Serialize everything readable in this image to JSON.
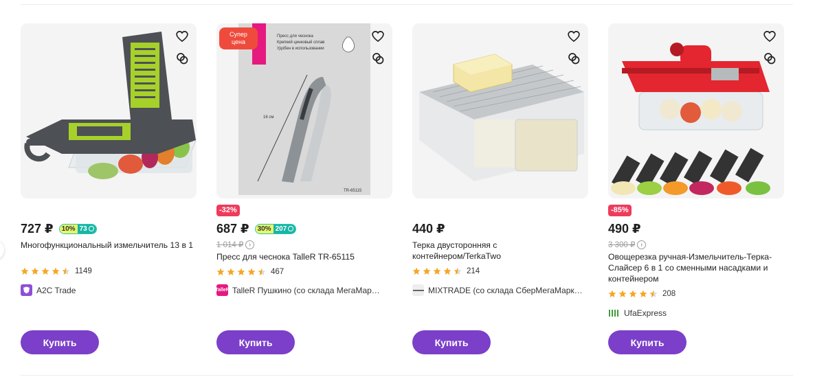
{
  "products": [
    {
      "price": "727 ₽",
      "bonus_pct": "10%",
      "bonus_amt": "73",
      "title": "Многофункциональный измельчитель 13 в 1",
      "rating_count": "1149",
      "seller": "A2C Trade",
      "buy_label": "Купить"
    },
    {
      "discount": "-32%",
      "price": "687 ₽",
      "bonus_pct": "30%",
      "bonus_amt": "207",
      "old_price": "1 014 ₽",
      "title": "Пресс для чеснока TalleR TR-65115",
      "rating_count": "467",
      "seller": "TalleR Пушкино (со склада МегаМар…",
      "seller_logo_text": "TalleR",
      "buy_label": "Купить",
      "img_badge": "Супер\nцена",
      "img_text_1": "Пресс для чеснока",
      "img_text_2": "Крепкий цинковый сплав",
      "img_text_3": "Удобен в использовании",
      "img_dim": "16 см",
      "img_model": "TR-65115",
      "img_brand": "TalleR"
    },
    {
      "price": "440 ₽",
      "title": "Терка двусторонняя с контейнером/TerkaTwo",
      "rating_count": "214",
      "seller": "MIXTRADE (со склада СберМегаМарк…",
      "buy_label": "Купить"
    },
    {
      "discount": "-85%",
      "price": "490 ₽",
      "old_price": "3 300 ₽",
      "title": "Овощерезка ручная-Измельчитель-Терка-Слайсер 6 в 1 со сменными насадками и контейнером",
      "rating_count": "208",
      "seller": "UfaExpress",
      "buy_label": "Купить"
    }
  ],
  "ratings": [
    4.5,
    4.5,
    4.5,
    4.5
  ],
  "colors": {
    "accent": "#7b3fc9",
    "discount": "#ee3b5c",
    "star": "#f5a623",
    "bonus": "#18b5a6"
  },
  "icons": [
    "heart-icon",
    "compare-icon",
    "star-icon",
    "info-icon",
    "coin-icon",
    "chevron-left-icon"
  ]
}
